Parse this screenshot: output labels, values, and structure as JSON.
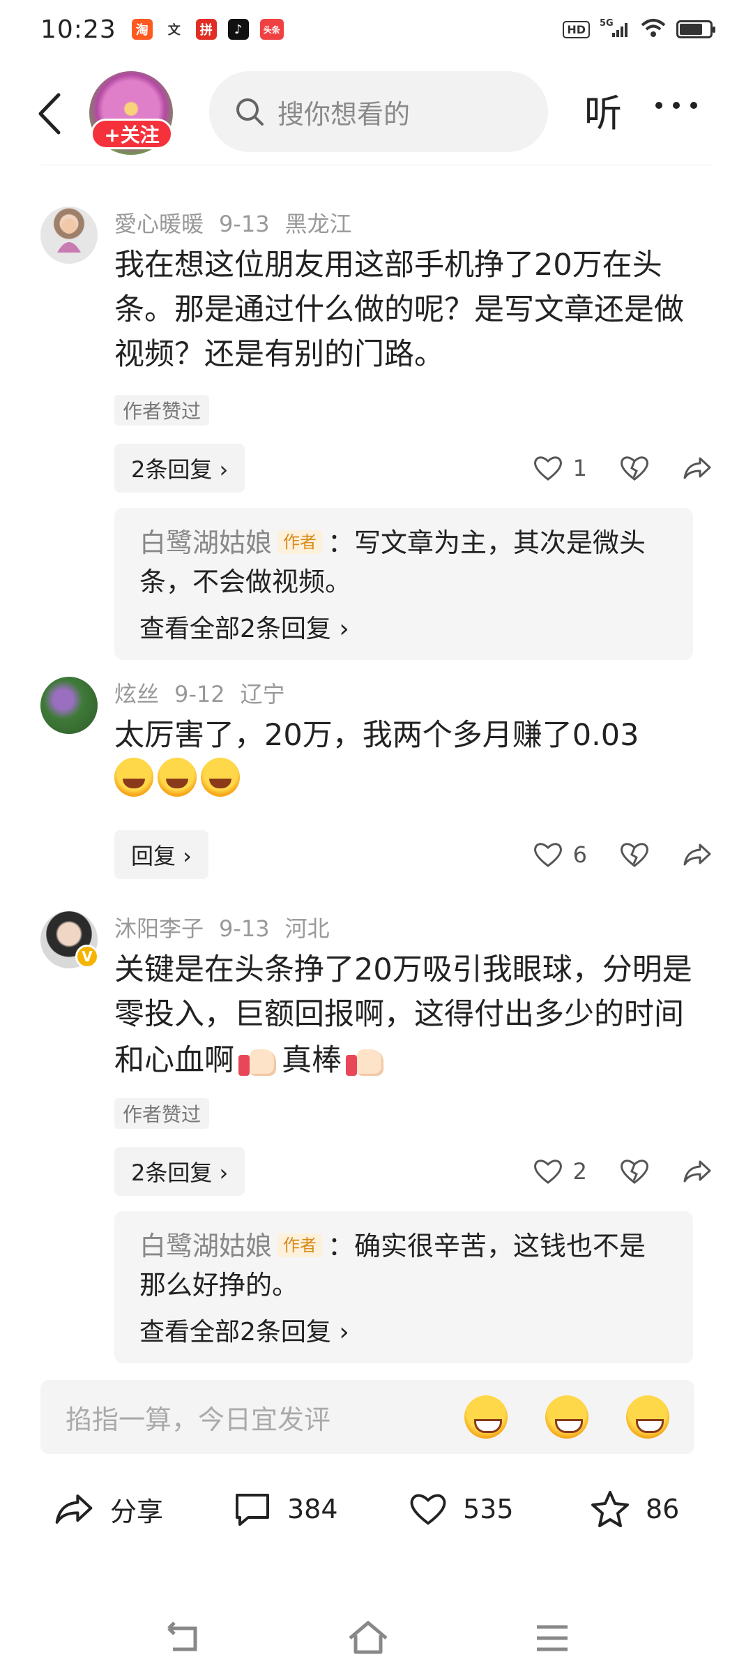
{
  "status_bar": {
    "time": "10:23",
    "notifications": [
      {
        "icon": "taobao-icon",
        "glyph": "淘",
        "color": "#ff5a1f"
      },
      {
        "icon": "wen-icon",
        "glyph": "文",
        "color": "#ffffff"
      },
      {
        "icon": "pinduoduo-icon",
        "glyph": "拼",
        "color": "#e02e24"
      },
      {
        "icon": "tiktok-icon",
        "glyph": "♪",
        "color": "#111111"
      },
      {
        "icon": "toutiao-icon",
        "glyph": "头条",
        "color": "#f04142"
      }
    ],
    "hd": "HD",
    "network": "5G",
    "battery_level": 0.7
  },
  "header": {
    "follow_label": "+关注",
    "search_placeholder": "搜你想看的",
    "listen_label": "听"
  },
  "comments": [
    {
      "user": "愛心暖暖",
      "date": "9-13",
      "location": "黑龙江",
      "text": "我在想这位朋友用这部手机挣了20万在头条。那是通过什么做的呢？是写文章还是做视频？还是有别的门路。",
      "author_liked": "作者赞过",
      "reply_chip": "2条回复 ›",
      "likes": "1",
      "reply": {
        "name": "白鹭湖姑娘",
        "tag": "作者",
        "text": "：写文章为主，其次是微头条，不会做视频。",
        "view_all": "查看全部2条回复 ›"
      }
    },
    {
      "user": "炫丝",
      "date": "9-12",
      "location": "辽宁",
      "text": "太厉害了，20万，我两个多月赚了0.03",
      "reply_chip": "回复 ›",
      "likes": "6"
    },
    {
      "user": "沐阳李子",
      "date": "9-13",
      "location": "河北",
      "text_part1": "关键是在头条挣了20万吸引我眼球，分明是零投入，巨额回报啊，这得付出多少的时间和心血啊",
      "text_part2": "真棒",
      "author_liked": "作者赞过",
      "reply_chip": "2条回复 ›",
      "likes": "2",
      "reply": {
        "name": "白鹭湖姑娘",
        "tag": "作者",
        "text": "：确实很辛苦，这钱也不是那么好挣的。",
        "view_all": "查看全部2条回复 ›"
      }
    }
  ],
  "comment_input": {
    "placeholder": "掐指一算，今日宜发评"
  },
  "bottom_bar": {
    "share_label": "分享",
    "comments_count": "384",
    "likes_count": "535",
    "favorites_count": "86"
  }
}
